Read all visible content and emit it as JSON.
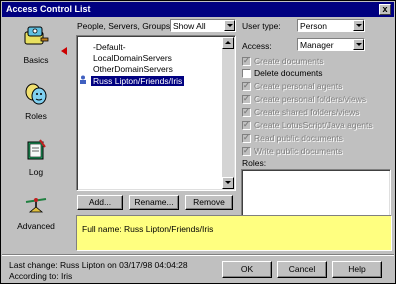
{
  "window": {
    "title": "Access Control List",
    "close_glyph": "x"
  },
  "nav": {
    "items": [
      {
        "label": "Basics",
        "icon": "key-icon"
      },
      {
        "label": "Roles",
        "icon": "masks-icon"
      },
      {
        "label": "Log",
        "icon": "book-icon"
      },
      {
        "label": "Advanced",
        "icon": "scale-icon"
      }
    ]
  },
  "people": {
    "label": "People, Servers, Groups:",
    "filter": "Show All",
    "entries": [
      "-Default-",
      "LocalDomainServers",
      "OtherDomainServers",
      "Russ Lipton/Friends/Iris"
    ],
    "selected": "Russ Lipton/Friends/Iris"
  },
  "buttons": {
    "add": "Add...",
    "rename": "Rename...",
    "remove": "Remove",
    "ok": "OK",
    "cancel": "Cancel",
    "help": "Help"
  },
  "user_type": {
    "label": "User type:",
    "value": "Person"
  },
  "access": {
    "label": "Access:",
    "value": "Manager"
  },
  "permissions": [
    {
      "label": "Create documents",
      "checked": true,
      "enabled": false
    },
    {
      "label": "Delete documents",
      "checked": false,
      "enabled": true
    },
    {
      "label": "Create personal agents",
      "checked": true,
      "enabled": false
    },
    {
      "label": "Create personal folders/views",
      "checked": true,
      "enabled": false
    },
    {
      "label": "Create shared folders/views",
      "checked": true,
      "enabled": false
    },
    {
      "label": "Create LotusScript/Java agents",
      "checked": true,
      "enabled": false
    },
    {
      "label": "Read public documents",
      "checked": true,
      "enabled": false
    },
    {
      "label": "Write public documents",
      "checked": true,
      "enabled": false
    }
  ],
  "roles": {
    "label": "Roles:"
  },
  "fullname": "Full name: Russ Lipton/Friends/Iris",
  "footer": {
    "last_change": "Last change:  Russ Lipton on 03/17/98 04:04:28",
    "according_to": "According to:  Iris"
  }
}
